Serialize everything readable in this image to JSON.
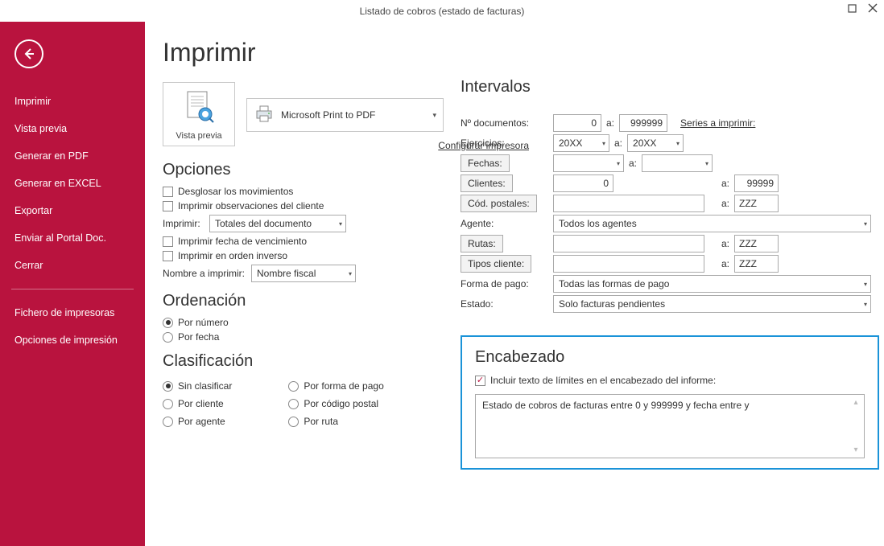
{
  "window": {
    "title": "Listado de cobros (estado de facturas)"
  },
  "sidebar": {
    "items": [
      "Imprimir",
      "Vista previa",
      "Generar en PDF",
      "Generar en EXCEL",
      "Exportar",
      "Enviar al Portal Doc.",
      "Cerrar"
    ],
    "items2": [
      "Fichero de impresoras",
      "Opciones de impresión"
    ]
  },
  "header": {
    "title": "Imprimir"
  },
  "preview": {
    "label": "Vista previa"
  },
  "printer": {
    "name": "Microsoft Print to PDF",
    "config": "Configurar impresora"
  },
  "opciones": {
    "title": "Opciones",
    "c1": "Desglosar los movimientos",
    "c2": "Imprimir observaciones del cliente",
    "imprimir_lbl": "Imprimir:",
    "imprimir_sel": "Totales del documento",
    "c3": "Imprimir fecha de vencimiento",
    "c4": "Imprimir en orden inverso",
    "nombre_lbl": "Nombre a imprimir:",
    "nombre_sel": "Nombre fiscal"
  },
  "ordenacion": {
    "title": "Ordenación",
    "r1": "Por número",
    "r2": "Por fecha"
  },
  "clasificacion": {
    "title": "Clasificación",
    "r1": "Sin clasificar",
    "r2": "Por cliente",
    "r3": "Por agente",
    "r4": "Por forma de pago",
    "r5": "Por código postal",
    "r6": "Por ruta"
  },
  "intervalos": {
    "title": "Intervalos",
    "ndoc_lbl": "Nº documentos:",
    "ndoc_from": "0",
    "a": "a:",
    "ndoc_to": "999999",
    "series": "Series a imprimir:",
    "ejer_lbl": "Ejercicios:",
    "ejer_from": "20XX",
    "ejer_to": "20XX",
    "fechas_btn": "Fechas:",
    "clientes_btn": "Clientes:",
    "clientes_from": "0",
    "clientes_to": "99999",
    "codpost_btn": "Cód. postales:",
    "codpost_to": "ZZZ",
    "agente_lbl": "Agente:",
    "agente_sel": "Todos los agentes",
    "rutas_btn": "Rutas:",
    "rutas_to": "ZZZ",
    "tipos_btn": "Tipos cliente:",
    "tipos_to": "ZZZ",
    "forma_lbl": "Forma de pago:",
    "forma_sel": "Todas las formas de pago",
    "estado_lbl": "Estado:",
    "estado_sel": "Solo facturas pendientes"
  },
  "encabezado": {
    "title": "Encabezado",
    "chk": "Incluir texto de límites en el encabezado del informe:",
    "txt": "Estado de cobros de facturas entre 0 y 999999 y fecha entre  y"
  }
}
